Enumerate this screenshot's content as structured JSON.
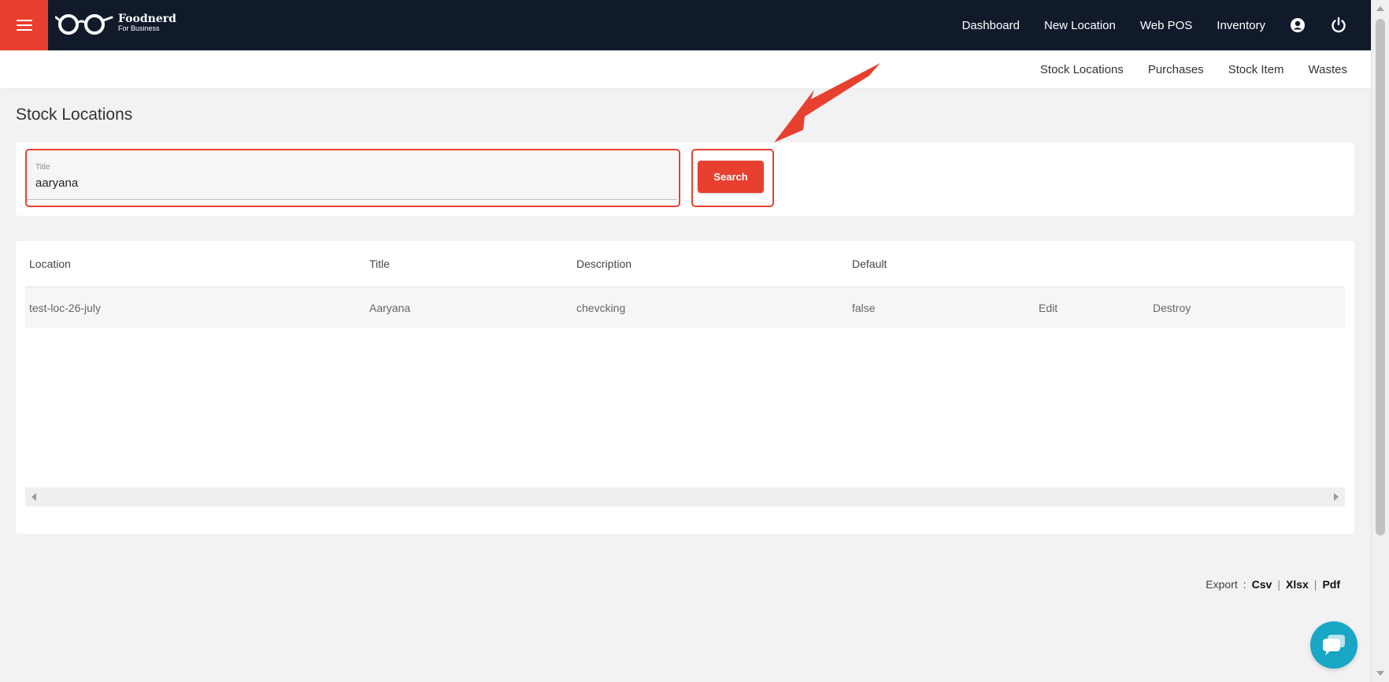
{
  "brand": {
    "name": "Foodnerd",
    "tagline": "For Business",
    "accent_color": "#e8402f",
    "header_color": "#111a2b"
  },
  "header": {
    "menu_icon": "hamburger-icon",
    "nav": [
      {
        "label": "Dashboard"
      },
      {
        "label": "New Location"
      },
      {
        "label": "Web POS"
      },
      {
        "label": "Inventory"
      }
    ],
    "icons": [
      "account-circle-icon",
      "power-icon"
    ]
  },
  "subnav": {
    "items": [
      {
        "label": "Stock Locations"
      },
      {
        "label": "Purchases"
      },
      {
        "label": "Stock Item"
      },
      {
        "label": "Wastes"
      }
    ]
  },
  "page": {
    "title": "Stock Locations"
  },
  "search": {
    "field_label": "Title",
    "field_value": "aaryana",
    "button_label": "Search"
  },
  "table": {
    "columns": [
      "Location",
      "Title",
      "Description",
      "Default"
    ],
    "rows": [
      {
        "location": "test-loc-26-july",
        "title": "Aaryana",
        "description": "chevcking",
        "default": "false",
        "edit": "Edit",
        "destroy": "Destroy"
      }
    ]
  },
  "export": {
    "label": "Export",
    "formats": [
      "Csv",
      "Xlsx",
      "Pdf"
    ]
  },
  "chat": {
    "icon": "chat-bubble-icon",
    "color": "#1aa6c5"
  }
}
